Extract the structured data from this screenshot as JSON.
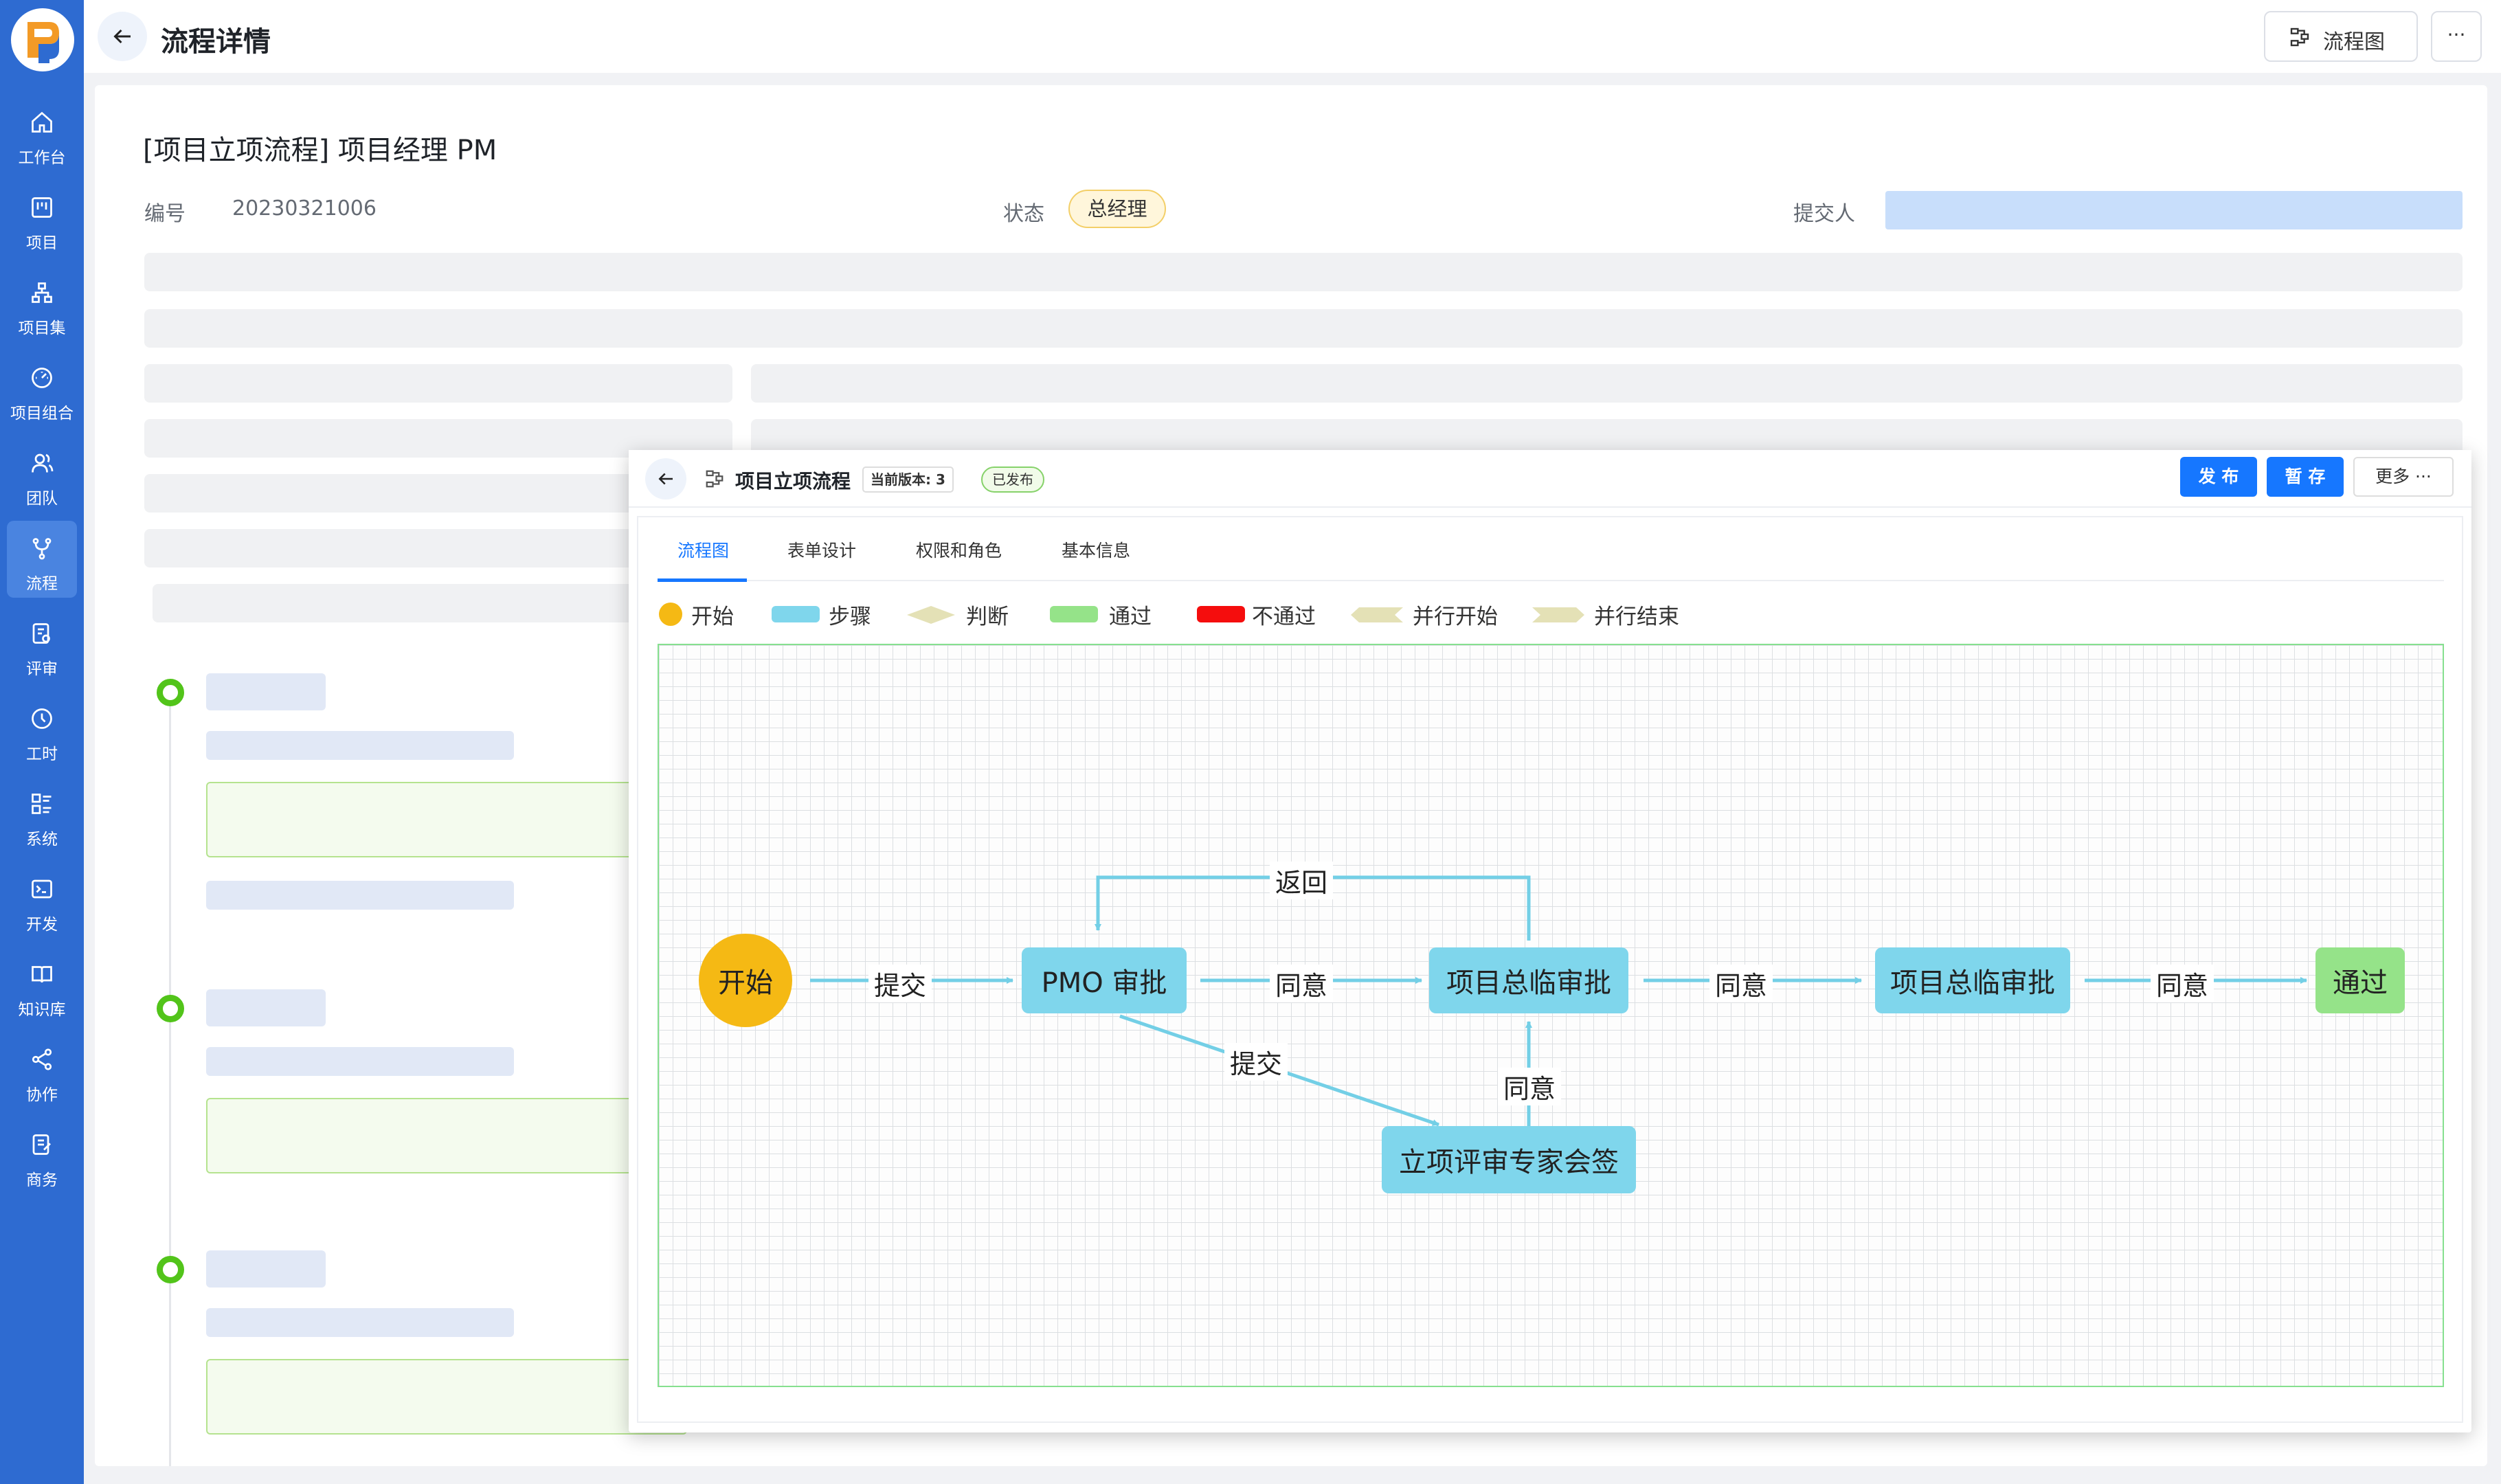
{
  "app": {
    "title": "流程详情"
  },
  "sidebar": {
    "items": [
      {
        "label": "工作台",
        "icon": "home-icon"
      },
      {
        "label": "项目",
        "icon": "board-icon"
      },
      {
        "label": "项目集",
        "icon": "sitemap-icon"
      },
      {
        "label": "项目组合",
        "icon": "dashboard-icon"
      },
      {
        "label": "团队",
        "icon": "team-icon"
      },
      {
        "label": "流程",
        "icon": "branch-icon",
        "active": true
      },
      {
        "label": "评审",
        "icon": "review-icon"
      },
      {
        "label": "工时",
        "icon": "clock-icon"
      },
      {
        "label": "系统",
        "icon": "grid-list-icon"
      },
      {
        "label": "开发",
        "icon": "terminal-icon"
      },
      {
        "label": "知识库",
        "icon": "book-icon"
      },
      {
        "label": "协作",
        "icon": "share-icon"
      },
      {
        "label": "商务",
        "icon": "contract-icon"
      }
    ]
  },
  "header": {
    "flow_button": "流程图",
    "more_button": "···"
  },
  "detail": {
    "title": "[项目立项流程] 项目经理 PM",
    "number_label": "编号",
    "number_value": "20230321006",
    "status_label": "状态",
    "status_value": "总经理",
    "submitter_label": "提交人"
  },
  "modal": {
    "title": "项目立项流程",
    "version": "当前版本: 3",
    "status_badge": "已发布",
    "publish_button": "发 布",
    "save_button": "暂 存",
    "more_button": "更多 ···",
    "tabs": [
      "流程图",
      "表单设计",
      "权限和角色",
      "基本信息"
    ],
    "active_tab": 0,
    "legend": [
      {
        "label": "开始",
        "color": "#f5b914",
        "shape": "circle"
      },
      {
        "label": "步骤",
        "color": "#7fd6ec",
        "shape": "rounded-rect"
      },
      {
        "label": "判断",
        "color": "#e4e1b6",
        "shape": "diamond"
      },
      {
        "label": "通过",
        "color": "#95e389",
        "shape": "rounded-rect"
      },
      {
        "label": "不通过",
        "color": "#f50d0d",
        "shape": "rounded-rect"
      },
      {
        "label": "并行开始",
        "color": "#e4e1b6",
        "shape": "hexagon"
      },
      {
        "label": "并行结束",
        "color": "#e4e1b6",
        "shape": "hexagon"
      }
    ]
  },
  "flow": {
    "nodes": {
      "start": "开始",
      "pmo": "PMO 审批",
      "pm_review_1": "项目总临审批",
      "pm_review_2": "项目总临审批",
      "pass": "通过",
      "expert": "立项评审专家会签"
    },
    "edges": {
      "submit_1": "提交",
      "agree_1": "同意",
      "agree_2": "同意",
      "agree_3": "同意",
      "return": "返回",
      "submit_2": "提交",
      "agree_4": "同意"
    }
  },
  "colors": {
    "sidebar": "#2e6bd1",
    "primary": "#1677ff",
    "step": "#7fd6ec",
    "start": "#f5b914",
    "pass": "#95e389",
    "edge": "#73cfe6",
    "timeline": "#52c41a"
  }
}
